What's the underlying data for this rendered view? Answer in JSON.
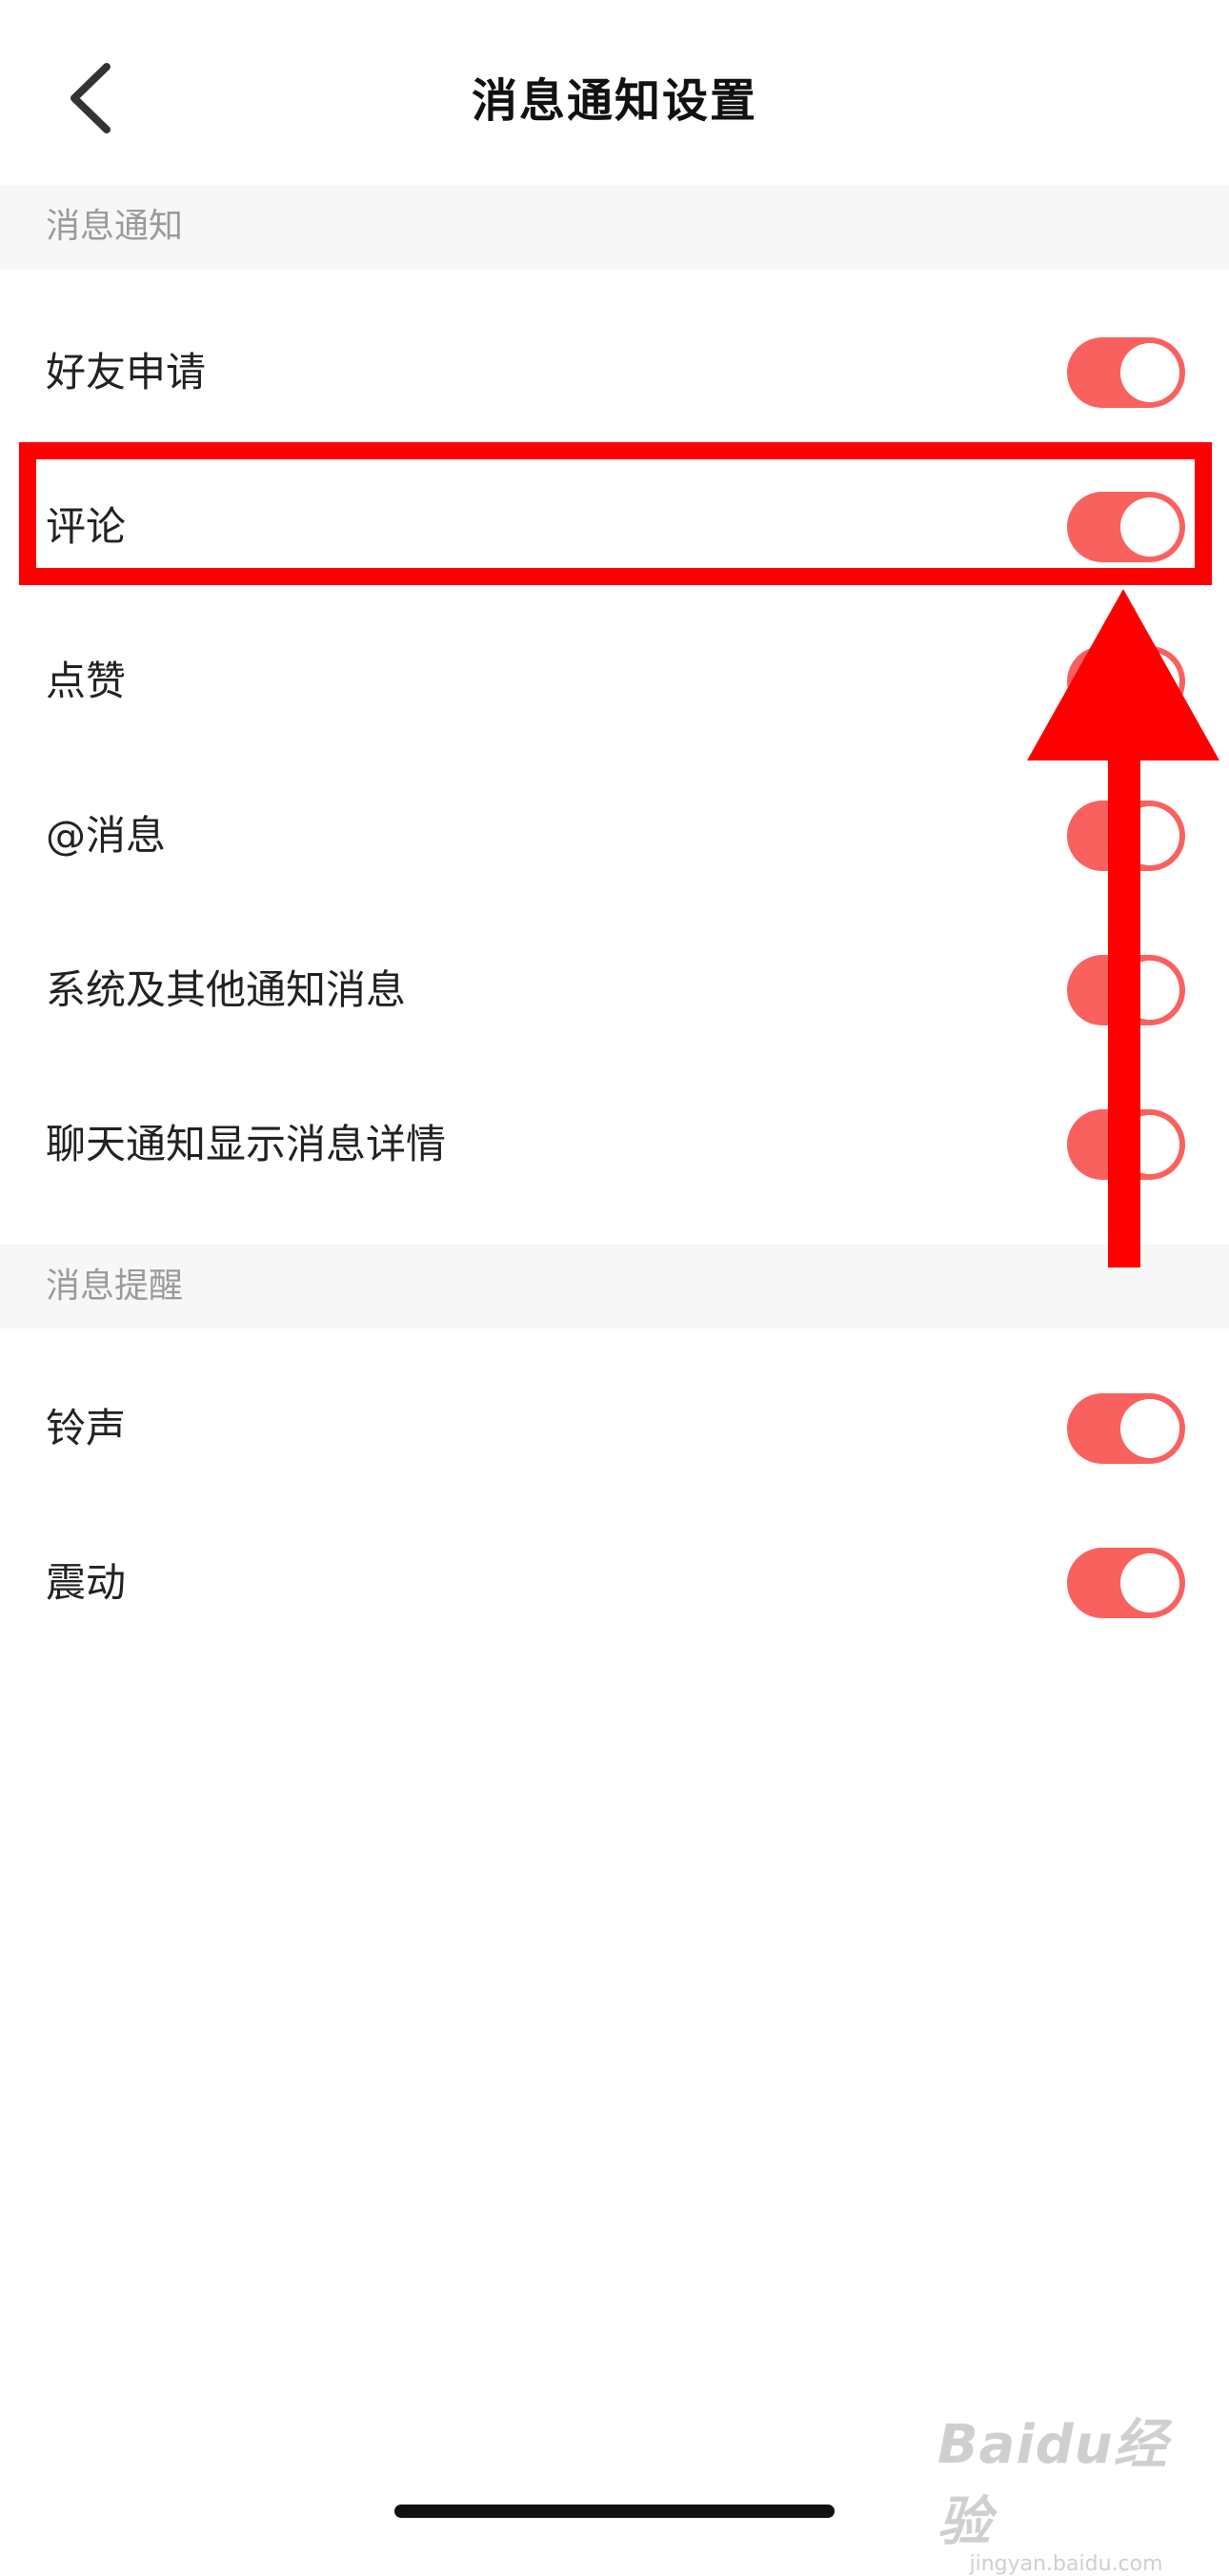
{
  "header": {
    "title": "消息通知设置",
    "back_icon": "chevron-left-icon"
  },
  "sections": [
    {
      "title": "消息通知",
      "items": [
        {
          "label": "好友申请",
          "enabled": true
        },
        {
          "label": "评论",
          "enabled": true
        },
        {
          "label": "点赞",
          "enabled": true
        },
        {
          "label": "@消息",
          "enabled": true
        },
        {
          "label": "系统及其他通知消息",
          "enabled": true
        },
        {
          "label": "聊天通知显示消息详情",
          "enabled": true
        }
      ]
    },
    {
      "title": "消息提醒",
      "items": [
        {
          "label": "铃声",
          "enabled": true
        },
        {
          "label": "震动",
          "enabled": true
        }
      ]
    }
  ],
  "colors": {
    "toggle_on": "#f9615f",
    "annotation": "#ff0000",
    "section_bg": "#f7f7f7"
  },
  "watermark": {
    "text": "Baidu经验",
    "sub": "jingyan.baidu.com"
  }
}
